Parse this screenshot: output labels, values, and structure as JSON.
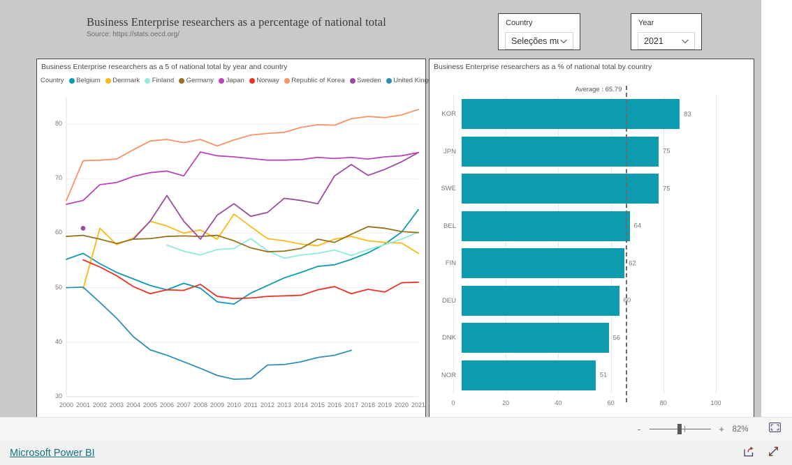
{
  "header": {
    "title": "Business Enterprise researchers as a percentage of national total",
    "source": "Source: https://stats.oecd.org/"
  },
  "slicers": {
    "country": {
      "label": "Country",
      "value": "Seleções múltip...",
      "icon": "chevron-down-icon"
    },
    "year": {
      "label": "Year",
      "value": "2021",
      "icon": "chevron-down-icon"
    }
  },
  "line_visual": {
    "title": "Business Enterprise researchers as a 5 of national total by year and country",
    "legend_title": "Country"
  },
  "bar_visual": {
    "title": "Business Enterprise researchers as a % of national total by country"
  },
  "bottom_bar": {
    "zoom_out_label": "-",
    "zoom_in_label": "+",
    "zoom_percent": "82%",
    "fit_icon": "fit-to-page-icon"
  },
  "footer": {
    "brand": "Microsoft Power BI",
    "share_icon": "share-icon",
    "fullscreen_icon": "fullscreen-icon"
  },
  "colors": {
    "bar_teal": "#0d9bb0",
    "average_line": "#6b6b6b",
    "canvas_background": "#c9c9c9",
    "brand_link": "#13747e"
  },
  "chart_data": [
    {
      "type": "line",
      "title": "Business Enterprise researchers as a 5 of national total by year and country",
      "xlabel": "",
      "ylabel": "",
      "ylim": [
        30,
        85
      ],
      "yticks": [
        30,
        40,
        50,
        60,
        70,
        80
      ],
      "grid": true,
      "legend": "top",
      "x": [
        2000,
        2001,
        2002,
        2003,
        2004,
        2005,
        2006,
        2007,
        2008,
        2009,
        2010,
        2011,
        2012,
        2013,
        2014,
        2015,
        2016,
        2017,
        2018,
        2019,
        2020,
        2021
      ],
      "series": [
        {
          "name": "Belgium",
          "color": "#0d9bb0",
          "values": [
            55.2,
            56.3,
            54.4,
            52.8,
            51.6,
            50.4,
            49.6,
            50.8,
            49.9,
            47.4,
            47.0,
            49.0,
            50.4,
            51.8,
            52.8,
            53.9,
            54.2,
            55.2,
            56.4,
            58.0,
            60.2,
            64.3
          ]
        },
        {
          "name": "Denmark",
          "color": "#fdb813",
          "values": [
            null,
            49.8,
            60.9,
            57.9,
            59.1,
            62.2,
            61.3,
            60.0,
            60.6,
            58.9,
            63.5,
            61.2,
            59.0,
            58.6,
            58.0,
            57.7,
            58.9,
            59.4,
            58.6,
            58.3,
            58.2,
            56.3
          ]
        },
        {
          "name": "Finland",
          "color": "#8ceddb",
          "values": [
            null,
            null,
            null,
            null,
            null,
            null,
            57.8,
            56.7,
            56.0,
            57.0,
            57.2,
            59.0,
            56.8,
            55.4,
            56.0,
            56.3,
            56.9,
            55.9,
            57.0,
            57.9,
            58.9,
            60.2
          ]
        },
        {
          "name": "Germany",
          "color": "#97711a",
          "values": [
            59.4,
            59.6,
            58.9,
            58.1,
            58.9,
            59.0,
            59.4,
            59.5,
            59.4,
            59.6,
            58.6,
            57.3,
            56.6,
            56.7,
            57.2,
            58.9,
            58.3,
            59.8,
            61.2,
            60.9,
            60.3,
            60.1
          ]
        },
        {
          "name": "Japan",
          "color": "#bb43bb",
          "values": [
            65.3,
            66.0,
            68.9,
            69.3,
            70.4,
            71.1,
            71.4,
            70.5,
            74.9,
            74.2,
            74.0,
            73.7,
            73.4,
            73.4,
            73.5,
            73.9,
            73.7,
            73.9,
            73.6,
            74.0,
            74.2,
            74.8
          ]
        },
        {
          "name": "Norway",
          "color": "#ee3124",
          "values": [
            null,
            55.1,
            53.8,
            52.2,
            50.2,
            48.9,
            49.6,
            49.5,
            50.6,
            48.4,
            48.0,
            48.1,
            48.4,
            48.5,
            48.6,
            49.6,
            50.2,
            48.9,
            49.7,
            49.2,
            50.9,
            51.0
          ]
        },
        {
          "name": "Republic of Korea",
          "color": "#fa9266",
          "values": [
            66.0,
            73.3,
            73.4,
            73.6,
            75.3,
            76.9,
            77.2,
            76.6,
            77.2,
            76.0,
            77.1,
            78.0,
            78.3,
            78.5,
            79.4,
            79.9,
            79.8,
            81.0,
            81.4,
            81.2,
            81.7,
            82.7
          ]
        },
        {
          "name": "Sweden",
          "color": "#9b4ba0",
          "values": [
            null,
            60.9,
            null,
            null,
            58.9,
            62.2,
            66.9,
            62.2,
            58.9,
            63.3,
            65.4,
            63.1,
            63.8,
            66.4,
            66.0,
            65.4,
            70.5,
            72.6,
            70.6,
            71.7,
            73.1,
            74.8
          ]
        },
        {
          "name": "United Kingdom",
          "color": "#2e8fba",
          "values": [
            50.0,
            50.1,
            47.3,
            44.4,
            41.0,
            38.6,
            37.6,
            36.4,
            35.2,
            33.9,
            33.2,
            33.3,
            35.8,
            35.9,
            36.4,
            37.2,
            37.6,
            38.5,
            null,
            null,
            null,
            null
          ]
        }
      ]
    },
    {
      "type": "bar",
      "orientation": "horizontal",
      "title": "Business Enterprise researchers as a % of national total by country",
      "xlabel": "",
      "ylabel": "",
      "xlim": [
        0,
        100
      ],
      "xticks": [
        0,
        20,
        40,
        60,
        80,
        100
      ],
      "categories": [
        "KOR",
        "JPN",
        "SWE",
        "BEL",
        "FIN",
        "DEU",
        "DNK",
        "NOR"
      ],
      "values": [
        83,
        75,
        75,
        64,
        62,
        60,
        56,
        51
      ],
      "bar_color": "#0d9bb0",
      "average": {
        "label": "Average : 65.79",
        "value": 65.79,
        "style": "dashed",
        "color": "#6b6b6b"
      }
    }
  ]
}
